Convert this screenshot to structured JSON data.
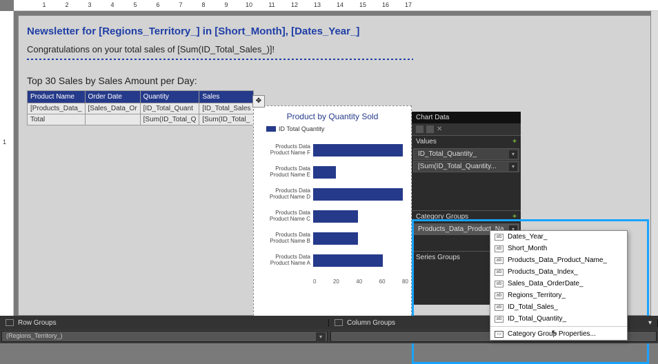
{
  "ruler": {
    "h": [
      1,
      2,
      3,
      4,
      5,
      6,
      7,
      8,
      9,
      10,
      11,
      12,
      13,
      14,
      15,
      16,
      17
    ],
    "v": [
      1
    ]
  },
  "page": {
    "title": "Newsletter for [Regions_Territory_] in [Short_Month], [Dates_Year_]",
    "congrats": "Congratulations on your total sales of [Sum(ID_Total_Sales_)]!",
    "subhead": "Top 30 Sales by Sales Amount per Day:"
  },
  "table": {
    "headers": [
      "Product Name",
      "Order Date",
      "Quantity",
      "Sales"
    ],
    "rows": [
      [
        "[Products_Data_",
        "[Sales_Data_Or",
        "[ID_Total_Quant",
        "[ID_Total_Sales"
      ],
      [
        "Total",
        "",
        "[Sum(ID_Total_Q",
        "[Sum(ID_Total_"
      ]
    ]
  },
  "chart_data": {
    "type": "bar",
    "orientation": "horizontal",
    "title": "Product by Quantity Sold",
    "legend": "ID Total Quantity",
    "categories": [
      "Products Data Product Name F",
      "Products Data Product Name E",
      "Products Data Product Name D",
      "Products Data Product Name C",
      "Products Data Product Name B",
      "Products Data Product Name A"
    ],
    "values": [
      80,
      20,
      80,
      40,
      40,
      62
    ],
    "xlabel": "",
    "ylabel": "",
    "xlim": [
      0,
      80
    ],
    "xticks": [
      0,
      20,
      40,
      60,
      80
    ]
  },
  "chart_data_pane": {
    "title": "Chart Data",
    "sections": {
      "values": {
        "label": "Values",
        "items": [
          "ID_Total_Quantity_",
          "[Sum(ID_Total_Quantity..."
        ]
      },
      "category_groups": {
        "label": "Category Groups",
        "items": [
          "Products_Data_Product_Na..."
        ]
      },
      "series_groups": {
        "label": "Series Groups",
        "items": []
      }
    }
  },
  "context_menu": {
    "items": [
      "Dates_Year_",
      "Short_Month",
      "Products_Data_Product_Name_",
      "Products_Data_Index_",
      "Sales_Data_OrderDate_",
      "Regions_Territory_",
      "ID_Total_Sales_",
      "ID_Total_Quantity_"
    ],
    "action": "Category Group Properties..."
  },
  "groups": {
    "row_label": "Row Groups",
    "col_label": "Column Groups",
    "row_value": "(Regions_Territory_)",
    "col_value": ""
  }
}
